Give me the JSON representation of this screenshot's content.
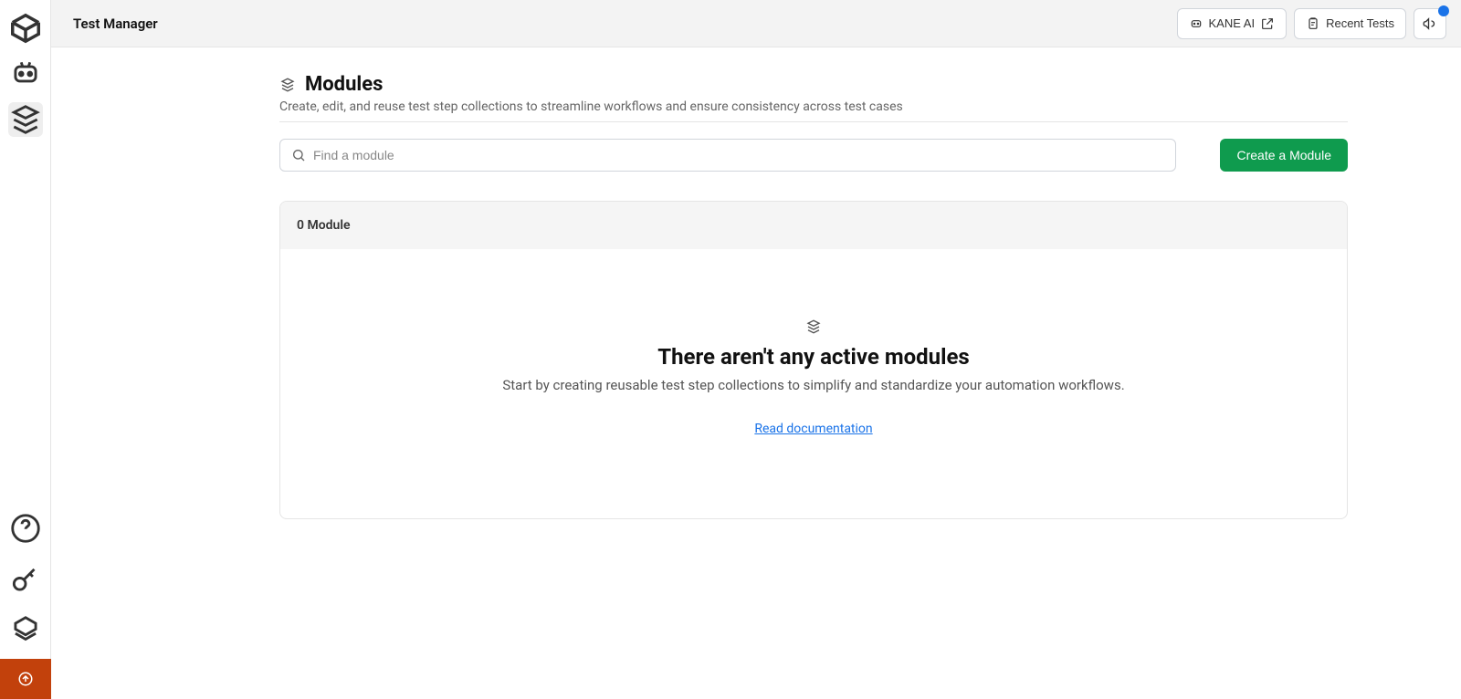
{
  "header": {
    "title": "Test Manager",
    "kane_ai_label": "KANE AI",
    "recent_tests_label": "Recent Tests"
  },
  "page": {
    "title": "Modules",
    "subtitle": "Create, edit, and reuse test step collections to streamline workflows and ensure consistency across test cases",
    "search_placeholder": "Find a module",
    "create_button": "Create a Module",
    "module_count_label": "0 Module",
    "empty_title": "There aren't any active modules",
    "empty_subtitle": "Start by creating reusable test step collections to simplify and standardize your automation workflows.",
    "doc_link": "Read documentation"
  }
}
